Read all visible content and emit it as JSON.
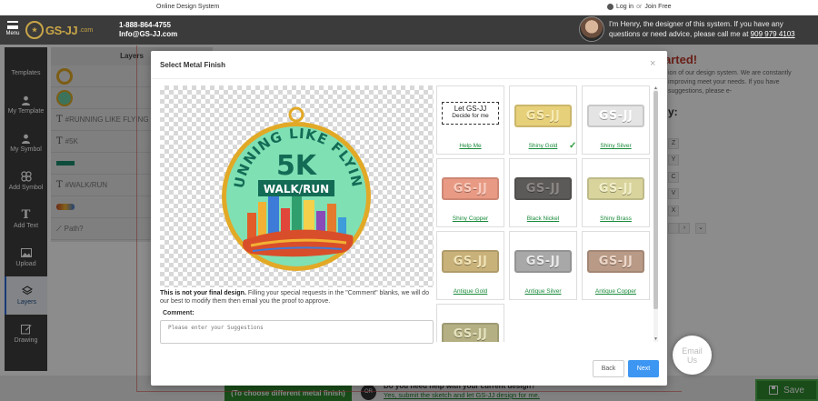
{
  "topbar": {
    "center_text": "Online Design System",
    "login": "Log in",
    "or": "or",
    "join": "Join Free"
  },
  "header": {
    "menu_label": "Menu",
    "logo_text": "GS-JJ",
    "logo_suffix": ".com",
    "phone": "1-888-864-4755",
    "email": "Info@GS-JJ.com",
    "designer_msg": "I'm Henry, the designer of this system. If you have any questions or need advice, please call me at",
    "designer_phone": "909 979 4103"
  },
  "sidebar": {
    "items": [
      {
        "label": "Templates",
        "icon": "grid-icon"
      },
      {
        "label": "My Template",
        "icon": "user-icon"
      },
      {
        "label": "My Symbol",
        "icon": "user-icon"
      },
      {
        "label": "Add Symbol",
        "icon": "clover-icon"
      },
      {
        "label": "Add Text",
        "icon": "text-icon"
      },
      {
        "label": "Upload",
        "icon": "image-icon"
      },
      {
        "label": "Layers",
        "icon": "layers-icon",
        "active": true
      },
      {
        "label": "Drawing",
        "icon": "pen-icon"
      }
    ]
  },
  "layers": {
    "title": "Layers",
    "rows": [
      {
        "type": "ring",
        "label": ""
      },
      {
        "type": "disc",
        "label": ""
      },
      {
        "type": "text",
        "label": "#RUNNING LIKE FLYING"
      },
      {
        "type": "text",
        "label": "#5K"
      },
      {
        "type": "bar",
        "label": ""
      },
      {
        "type": "text",
        "label": "#WALK/RUN"
      },
      {
        "type": "skyline",
        "label": ""
      },
      {
        "type": "path",
        "label": "Path?"
      }
    ]
  },
  "background": {
    "heading": "arted!",
    "paragraph": "ion of our design system. We are constantly improving meet your needs. If you have suggestions, please e-",
    "subheading": "y:",
    "letters": [
      "Z",
      "Y",
      "C",
      "V",
      "X"
    ]
  },
  "modal": {
    "title": "Select Metal Finish",
    "close": "×",
    "note_bold": "This is not your final design.",
    "note_rest": " Filling your special requests in the \"Comment\" blanks, we will do our best to modify them then email you the proof to approve.",
    "comment_label": "Comment:",
    "comment_placeholder": "Please enter your Suggestions",
    "back_label": "Back",
    "next_label": "Next",
    "help_line1": "Let GS-JJ",
    "help_line2": "Decide for me",
    "plate_text": "GS-JJ",
    "finishes": [
      {
        "label": "Help Me",
        "kind": "help"
      },
      {
        "label": "Shiny Gold",
        "bg": "#e7d07a",
        "fg": "#f7ebb2",
        "selected": true
      },
      {
        "label": "Shiny Silver",
        "bg": "#e4e4e4",
        "fg": "#ffffff"
      },
      {
        "label": "Shiny Copper",
        "bg": "#e99a84",
        "fg": "#f8cbbd"
      },
      {
        "label": "Black Nickel",
        "bg": "#5c5a58",
        "fg": "#8a8784"
      },
      {
        "label": "Shiny Brass",
        "bg": "#d9d49c",
        "fg": "#f2efc9"
      },
      {
        "label": "Antique Gold",
        "bg": "#c9b27a",
        "fg": "#f1e3b6"
      },
      {
        "label": "Antique Silver",
        "bg": "#a8a8a8",
        "fg": "#e8e8e8"
      },
      {
        "label": "Antique Copper",
        "bg": "#b99a86",
        "fg": "#ecd7c9"
      },
      {
        "label": "",
        "bg": "#b4b083",
        "fg": "#e4e1bd"
      }
    ],
    "medal": {
      "arc_text": "RUNNING LIKE FLYING",
      "big": "5K",
      "ribbon": "WALK/RUN"
    }
  },
  "bottom": {
    "green_label": "(To choose different metal finish)",
    "or": "OR",
    "line1": "Do you need help with your current design?",
    "line2": "Yes, submit the sketch and let GS-JJ design for me.",
    "save_label": "Save"
  },
  "email_widget": {
    "line1": "Email",
    "line2": "Us"
  },
  "colors": {
    "accent": "#3d96f2",
    "green": "#2e8b2e",
    "header": "#3b3b3b",
    "gold": "#c9a547"
  }
}
